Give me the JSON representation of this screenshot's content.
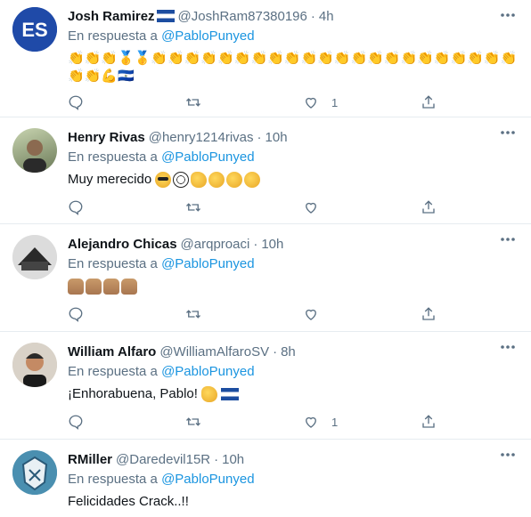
{
  "tweets": [
    {
      "name": "Josh Ramirez",
      "handle": "@JoshRam87380196",
      "time": "4h",
      "reply_prefix": "En respuesta a",
      "mention": "@PabloPunyed",
      "text": "",
      "emoji_line": "👏👏👏🥇🥇👏👏👏👏👏👏👏👏👏👏👏👏👏👏👏👏👏👏👏👏👏👏👏👏💪🇸🇻",
      "like_count": "1",
      "avatar_color": "#1f4aa8",
      "avatar_text": "ES"
    },
    {
      "name": "Henry Rivas",
      "handle": "@henry1214rivas",
      "time": "10h",
      "reply_prefix": "En respuesta a",
      "mention": "@PabloPunyed",
      "text": "Muy merecido",
      "like_count": "",
      "avatar_color": "#8a9a7a"
    },
    {
      "name": "Alejandro Chicas",
      "handle": "@arqproaci",
      "time": "10h",
      "reply_prefix": "En respuesta a",
      "mention": "@PabloPunyed",
      "text": "",
      "like_count": "",
      "avatar_color": "#2a2a2a"
    },
    {
      "name": "William Alfaro",
      "handle": "@WilliamAlfaroSV",
      "time": "8h",
      "reply_prefix": "En respuesta a",
      "mention": "@PabloPunyed",
      "text": "¡Enhorabuena, Pablo!",
      "like_count": "1",
      "avatar_color": "#3a3a3a"
    },
    {
      "name": "RMiller",
      "handle": "@Daredevil15R",
      "time": "10h",
      "reply_prefix": "En respuesta a",
      "mention": "@PabloPunyed",
      "text": "Felicidades Crack..!!",
      "like_count": "",
      "avatar_color": "#4a8fb0"
    }
  ],
  "separator": "·",
  "colors": {
    "mention": "#1b95e0",
    "muted": "#5b7083",
    "border": "#e6ecf0"
  }
}
